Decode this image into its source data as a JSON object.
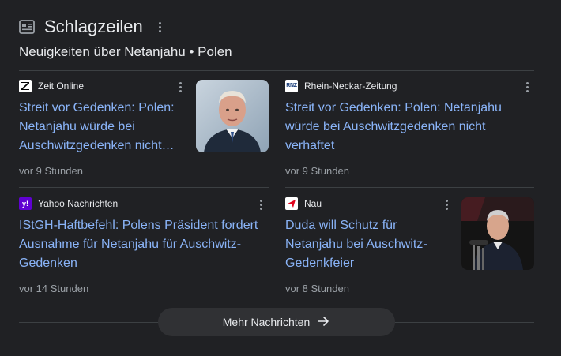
{
  "header": {
    "title": "Schlagzeilen",
    "subtitle": "Neuigkeiten über Netanjahu • Polen",
    "icon": "newspaper-icon"
  },
  "articles": [
    {
      "source": "Zeit Online",
      "source_logo": "Z",
      "headline": "Streit vor Gedenken: Polen: Netanjahu würde bei Auschwitzgedenken nicht…",
      "time": "vor 9 Stunden",
      "has_thumbnail": true
    },
    {
      "source": "Rhein-Neckar-Zeitung",
      "source_logo": "RNZ",
      "headline": "Streit vor Gedenken: Polen: Netanjahu würde bei Auschwitzgedenken nicht verhaftet",
      "time": "vor 9 Stunden",
      "has_thumbnail": false
    },
    {
      "source": "Yahoo Nachrichten",
      "source_logo": "y!",
      "headline": "IStGH-Haftbefehl: Polens Präsident fordert Ausnahme für Netanjahu für Auschwitz-Gedenken",
      "time": "vor 14 Stunden",
      "has_thumbnail": false
    },
    {
      "source": "Nau",
      "source_logo": "nau",
      "headline": "Duda will Schutz für Netanjahu bei Auschwitz-Gedenkfeier",
      "time": "vor 8 Stunden",
      "has_thumbnail": true
    }
  ],
  "more_button": {
    "label": "Mehr Nachrichten",
    "icon": "arrow-right-icon"
  },
  "colors": {
    "background": "#202124",
    "link": "#8ab4f8",
    "text": "#e8eaed",
    "muted": "#9aa0a6",
    "divider": "#3c4043",
    "button": "#303134"
  }
}
